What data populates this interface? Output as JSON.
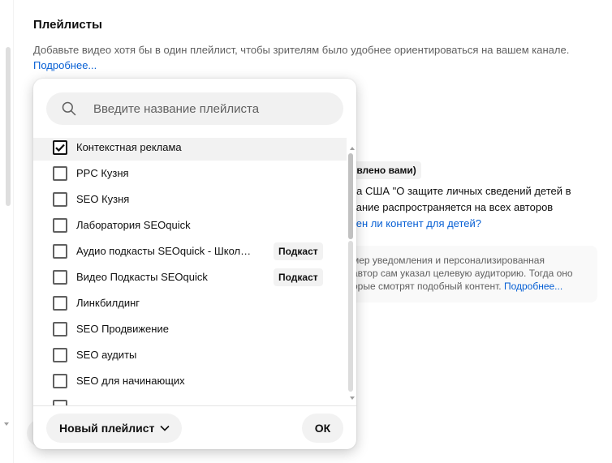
{
  "section": {
    "title": "Плейлисты",
    "description": "Добавьте видео хотя бы в один плейлист, чтобы зрителям было удобнее ориентироваться на вашем канале.",
    "more_link": "Подробнее..."
  },
  "background": {
    "chip_text": "овлено вами)",
    "line1": "на США \"О защите личных сведений детей в",
    "line2": "вание распространяется на всех авторов",
    "line3_link": "чен ли контент для детей?",
    "info_line1": "мер уведомления и персонализированная",
    "info_line2": "автор сам указал целевую аудиторию. Тогда оно",
    "info_line3": "орые смотрят подобный контент.",
    "info_link": "Подробнее..."
  },
  "popup": {
    "search": {
      "placeholder": "Введите название плейлиста",
      "value": ""
    },
    "items": [
      {
        "label": "Контекстная реклама",
        "checked": true,
        "tag": ""
      },
      {
        "label": "PPC Кузня",
        "checked": false,
        "tag": ""
      },
      {
        "label": "SEO Кузня",
        "checked": false,
        "tag": ""
      },
      {
        "label": "Лаборатория SEOquick",
        "checked": false,
        "tag": ""
      },
      {
        "label": "Аудио подкасты SEOquick - Школа ...",
        "checked": false,
        "tag": "Подкаст"
      },
      {
        "label": "Видео Подкасты SEOquick",
        "checked": false,
        "tag": "Подкаст"
      },
      {
        "label": "Линкбилдинг",
        "checked": false,
        "tag": ""
      },
      {
        "label": "SEO Продвижение",
        "checked": false,
        "tag": ""
      },
      {
        "label": "SEO аудиты",
        "checked": false,
        "tag": ""
      },
      {
        "label": "SEO для начинающих",
        "checked": false,
        "tag": ""
      }
    ],
    "new_playlist_label": "Новый плейлист",
    "ok_label": "ОК"
  },
  "icons": {
    "search": "search-icon",
    "checkmark": "checkmark-icon",
    "chevron": "chevron-down-icon"
  }
}
